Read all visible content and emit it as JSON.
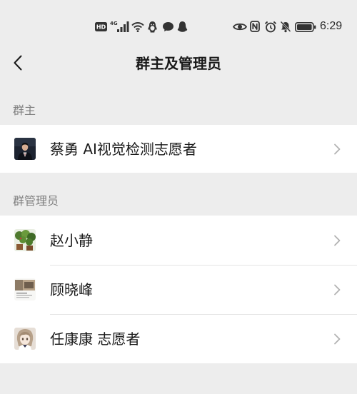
{
  "status_bar": {
    "time": "6:29",
    "hd_label": "HD",
    "network_label": "4G",
    "left_icons": [
      "hd-icon",
      "signal-4g-icon",
      "wifi-icon",
      "qq-icon",
      "chat-bubble-icon",
      "qq-notification-icon"
    ],
    "right_icons": [
      "eye-icon",
      "nfc-icon",
      "alarm-icon",
      "bell-off-icon",
      "battery-icon"
    ]
  },
  "header": {
    "title": "群主及管理员",
    "back_icon": "back-arrow-icon"
  },
  "sections": [
    {
      "label": "群主",
      "members": [
        {
          "name": "蔡勇 AI视觉检测志愿者"
        }
      ]
    },
    {
      "label": "群管理员",
      "members": [
        {
          "name": "赵小静"
        },
        {
          "name": "顾晓峰"
        },
        {
          "name": "任康康 志愿者"
        }
      ]
    }
  ],
  "row_icon": "chevron-right-icon",
  "colors": {
    "background": "#ededed",
    "row_background": "#ffffff",
    "text": "#191919",
    "section_label": "#7f7f7f",
    "chevron": "#b2b2b2",
    "divider": "#e5e5e5"
  }
}
